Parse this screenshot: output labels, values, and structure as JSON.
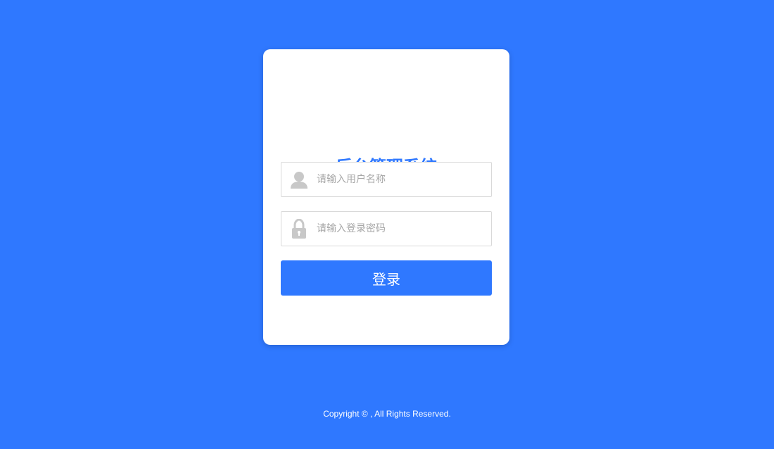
{
  "login": {
    "title": "后台管理系统",
    "username": {
      "value": "",
      "placeholder": "请输入用户名称",
      "icon": "user-icon"
    },
    "password": {
      "value": "",
      "placeholder": "请输入登录密码",
      "icon": "lock-icon"
    },
    "submit_label": "登录"
  },
  "footer": {
    "copyright": "Copyright © , All Rights Reserved."
  },
  "colors": {
    "background": "#2f78ff",
    "title": "#2f78ff",
    "button": "#2f78ff",
    "card": "#ffffff",
    "input_border": "#d9d9d9",
    "icon": "#c8c8c8"
  }
}
